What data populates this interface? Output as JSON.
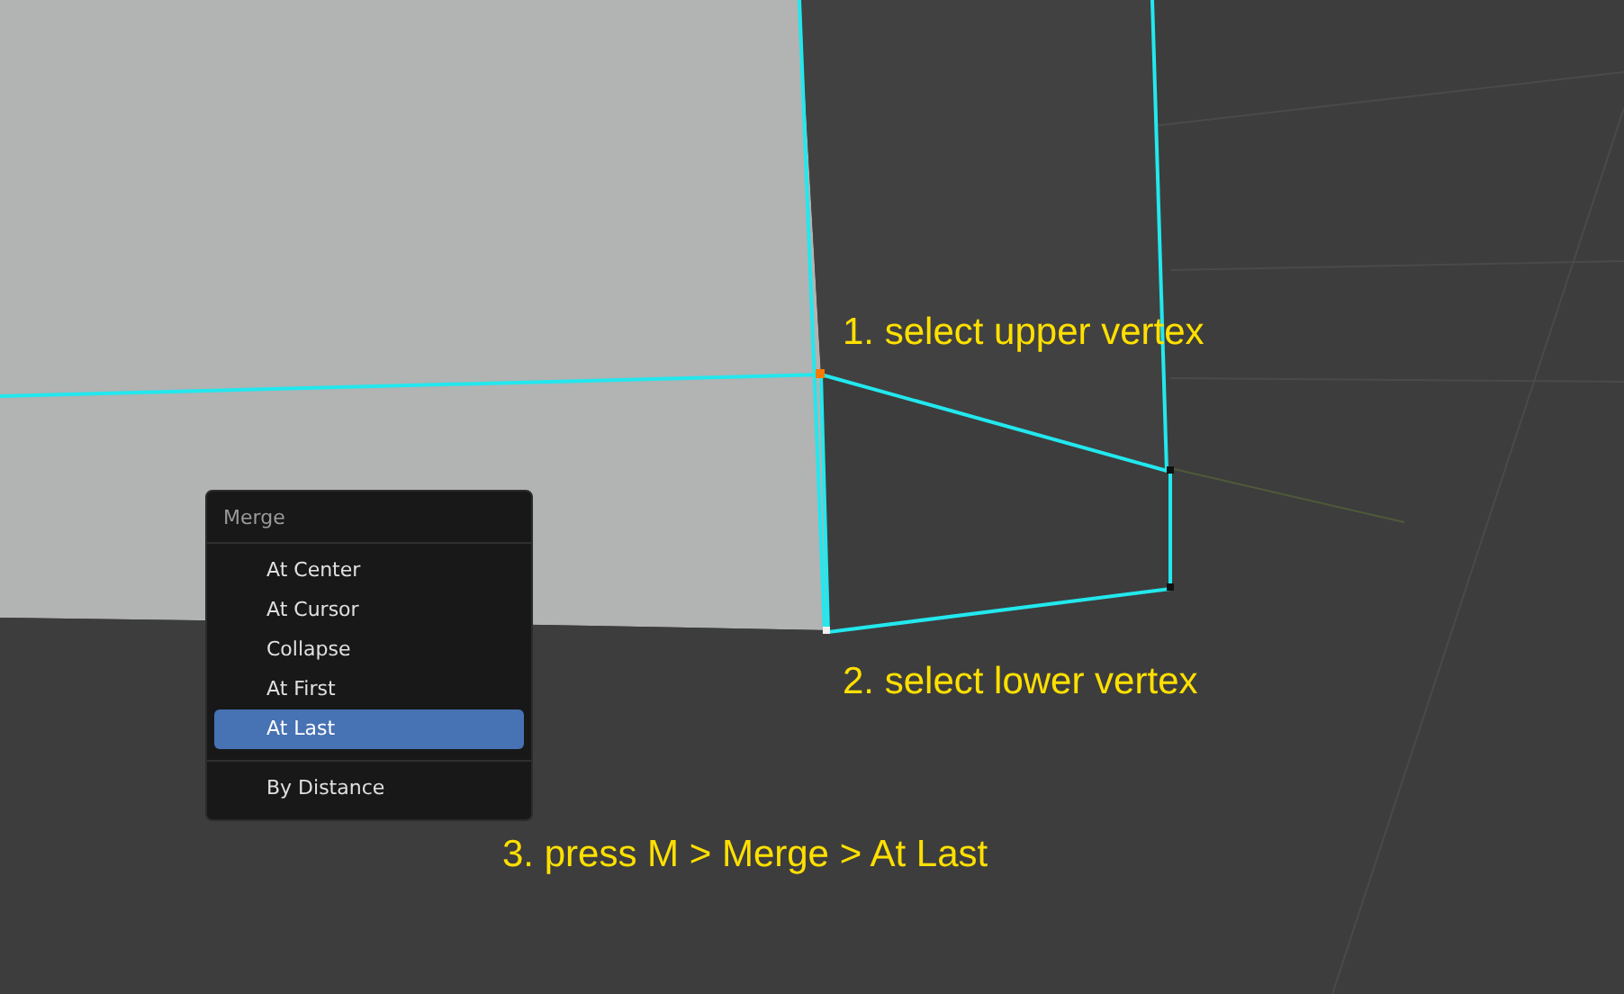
{
  "annotations": [
    "1. select upper vertex",
    "2. select lower vertex",
    "3. press M > Merge > At Last"
  ],
  "menu": {
    "title": "Merge",
    "items": [
      {
        "label": "At Center",
        "selected": false
      },
      {
        "label": "At Cursor",
        "selected": false
      },
      {
        "label": "Collapse",
        "selected": false
      },
      {
        "label": "At First",
        "selected": false
      },
      {
        "label": "At Last",
        "selected": true
      }
    ],
    "extra_items": [
      {
        "label": "By Distance",
        "selected": false
      }
    ]
  }
}
